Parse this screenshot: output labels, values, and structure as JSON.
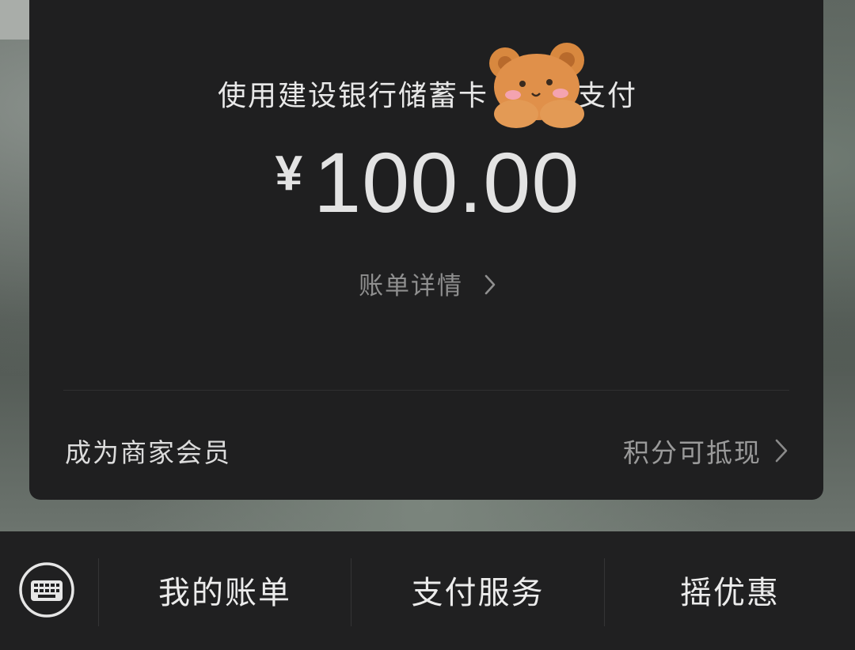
{
  "payment": {
    "method_line": "使用建设银行储蓄卡",
    "method_suffix": "支付",
    "currency_symbol": "¥",
    "amount": "100.00",
    "details_link": "账单详情"
  },
  "promo": {
    "member_label": "成为商家会员",
    "points_label": "积分可抵现"
  },
  "bottom_menu": {
    "keyboard_icon": "keyboard-icon",
    "items": [
      {
        "label": "我的账单"
      },
      {
        "label": "支付服务"
      },
      {
        "label": "摇优惠"
      }
    ]
  },
  "colors": {
    "card_bg": "#1f1f20",
    "bar_bg": "#202021",
    "text_primary": "#e8e8e8",
    "text_secondary": "#8f8f8f"
  }
}
